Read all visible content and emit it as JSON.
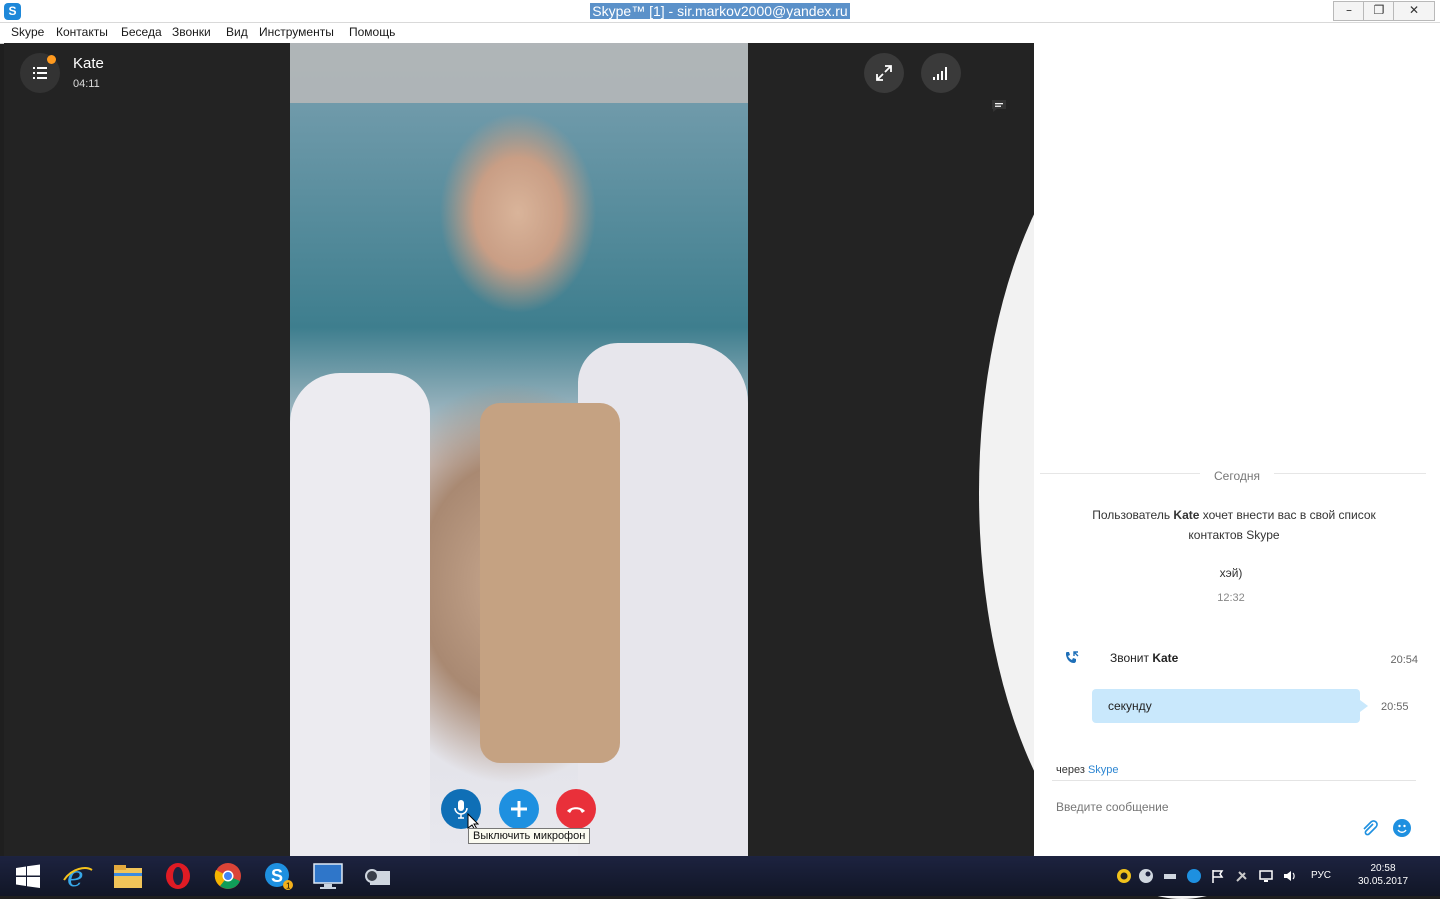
{
  "window": {
    "title": "Skype™ [1] - sir.markov2000@yandex.ru",
    "app_icon": "skype-icon"
  },
  "menu": [
    "Skype",
    "Контакты",
    "Беседа",
    "Звонки",
    "Вид",
    "Инструменты",
    "Помощь"
  ],
  "call": {
    "contact_name": "Kate",
    "duration": "04:11",
    "has_notification": true,
    "top_controls": [
      "fullscreen-icon",
      "signal-icon",
      "chat-icon"
    ],
    "bottom_controls": [
      "microphone-icon",
      "add-icon",
      "hangup-icon"
    ],
    "tooltip": "Выключить микрофон"
  },
  "chat": {
    "date_divider": "Сегодня",
    "system_message": {
      "prefix": "Пользователь",
      "user": "Kate",
      "suffix": "хочет внести вас в свой список контактов Skype"
    },
    "messages": [
      {
        "text": "хэй)",
        "time": "12:32"
      }
    ],
    "call_event": {
      "prefix": "Звонит",
      "user": "Kate",
      "time": "20:54"
    },
    "bubble": {
      "text": "секунду",
      "time": "20:55"
    },
    "via": {
      "prefix": "через",
      "link": "Skype"
    },
    "input_placeholder": "Введите сообщение"
  },
  "taskbar": {
    "apps": [
      "windows-start-icon",
      "internet-explorer-icon",
      "file-explorer-icon",
      "opera-icon",
      "chrome-icon",
      "skype-icon",
      "monitor-icon",
      "media-icon"
    ],
    "skype_badge": "1",
    "language": "РУС",
    "time": "20:58",
    "date": "30.05.2017"
  },
  "colors": {
    "accent": "#1e90e0",
    "hangup": "#e9303a",
    "bubble": "#c9e8fc",
    "call_bg": "#232323"
  }
}
